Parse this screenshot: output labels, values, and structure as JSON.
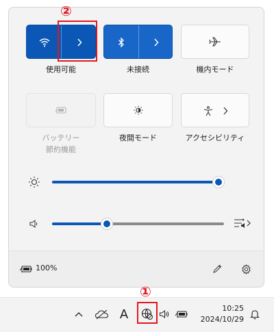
{
  "tiles": {
    "wifi": {
      "label": "使用可能"
    },
    "bluetooth": {
      "label": "未接続"
    },
    "airplane": {
      "label": "機内モード"
    },
    "battery_saver": {
      "label_line1": "バッテリー",
      "label_line2": "節約機能"
    },
    "night_light": {
      "label": "夜間モード"
    },
    "accessibility": {
      "label": "アクセシビリティ"
    }
  },
  "sliders": {
    "brightness": {
      "value": 1.0
    },
    "volume": {
      "value": 0.32
    }
  },
  "footer": {
    "battery_percent": "100%"
  },
  "annotations": {
    "one": "①",
    "two": "②"
  },
  "taskbar": {
    "ime": "A",
    "time": "10:25",
    "date": "2024/10/29"
  },
  "colors": {
    "accent": "#0a57b5",
    "marker": "#e0161f"
  },
  "icons": [
    "wifi-icon",
    "chevron-right-icon",
    "bluetooth-icon",
    "airplane-icon",
    "battery-saver-icon",
    "night-light-icon",
    "accessibility-icon",
    "sun-icon",
    "speaker-icon",
    "audio-output-icon",
    "battery-icon",
    "pen-icon",
    "gear-icon",
    "chevron-up-icon",
    "onedrive-icon",
    "globe-disconnected-icon",
    "bell-icon"
  ]
}
